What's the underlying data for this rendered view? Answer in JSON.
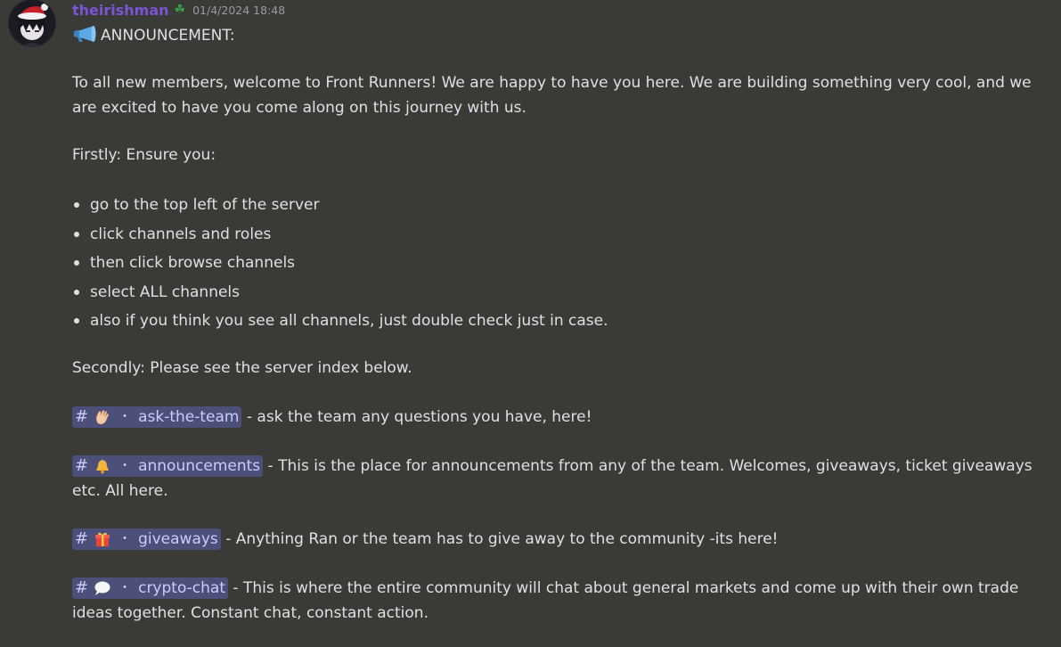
{
  "author": {
    "username": "theirishman",
    "badge_icon": "clover-icon",
    "timestamp": "01/4/2024 18:48",
    "name_color": "#7b55d6"
  },
  "message": {
    "heading_icon": "megaphone-icon",
    "heading": "ANNOUNCEMENT:",
    "intro": "To all new members, welcome to Front Runners! We are happy to have you here. We are building something very cool, and we are excited to have you come along on this journey with us.",
    "firstly": "Firstly: Ensure you:",
    "steps": [
      "go to the top left of the server",
      "click channels and roles",
      "then click browse channels",
      "select ALL channels",
      "also if you think you see all channels, just double check just in case."
    ],
    "secondly": "Secondly: Please see the server index below.",
    "channels": [
      {
        "hash": "#",
        "emoji": "waving-hand-icon",
        "separator": "・",
        "name": "ask-the-team",
        "description": " - ask the team any questions you have, here!"
      },
      {
        "hash": "#",
        "emoji": "bell-icon",
        "separator": "・",
        "name": "announcements",
        "description": " - This is the place for announcements from any of the team. Welcomes, giveaways, ticket giveaways etc. All here."
      },
      {
        "hash": "#",
        "emoji": "gift-icon",
        "separator": "・",
        "name": "giveaways",
        "description": " - Anything Ran or the team has to give away to the community -its here!"
      },
      {
        "hash": "#",
        "emoji": "speech-bubble-icon",
        "separator": "・",
        "name": "crypto-chat",
        "description": " - This is where the entire community will chat about general markets and come up with their own trade ideas together. Constant chat, constant action."
      }
    ]
  },
  "colors": {
    "background": "#3a3a37",
    "mention_bg": "#4b4f7a",
    "mention_text": "#c9cdfb"
  }
}
